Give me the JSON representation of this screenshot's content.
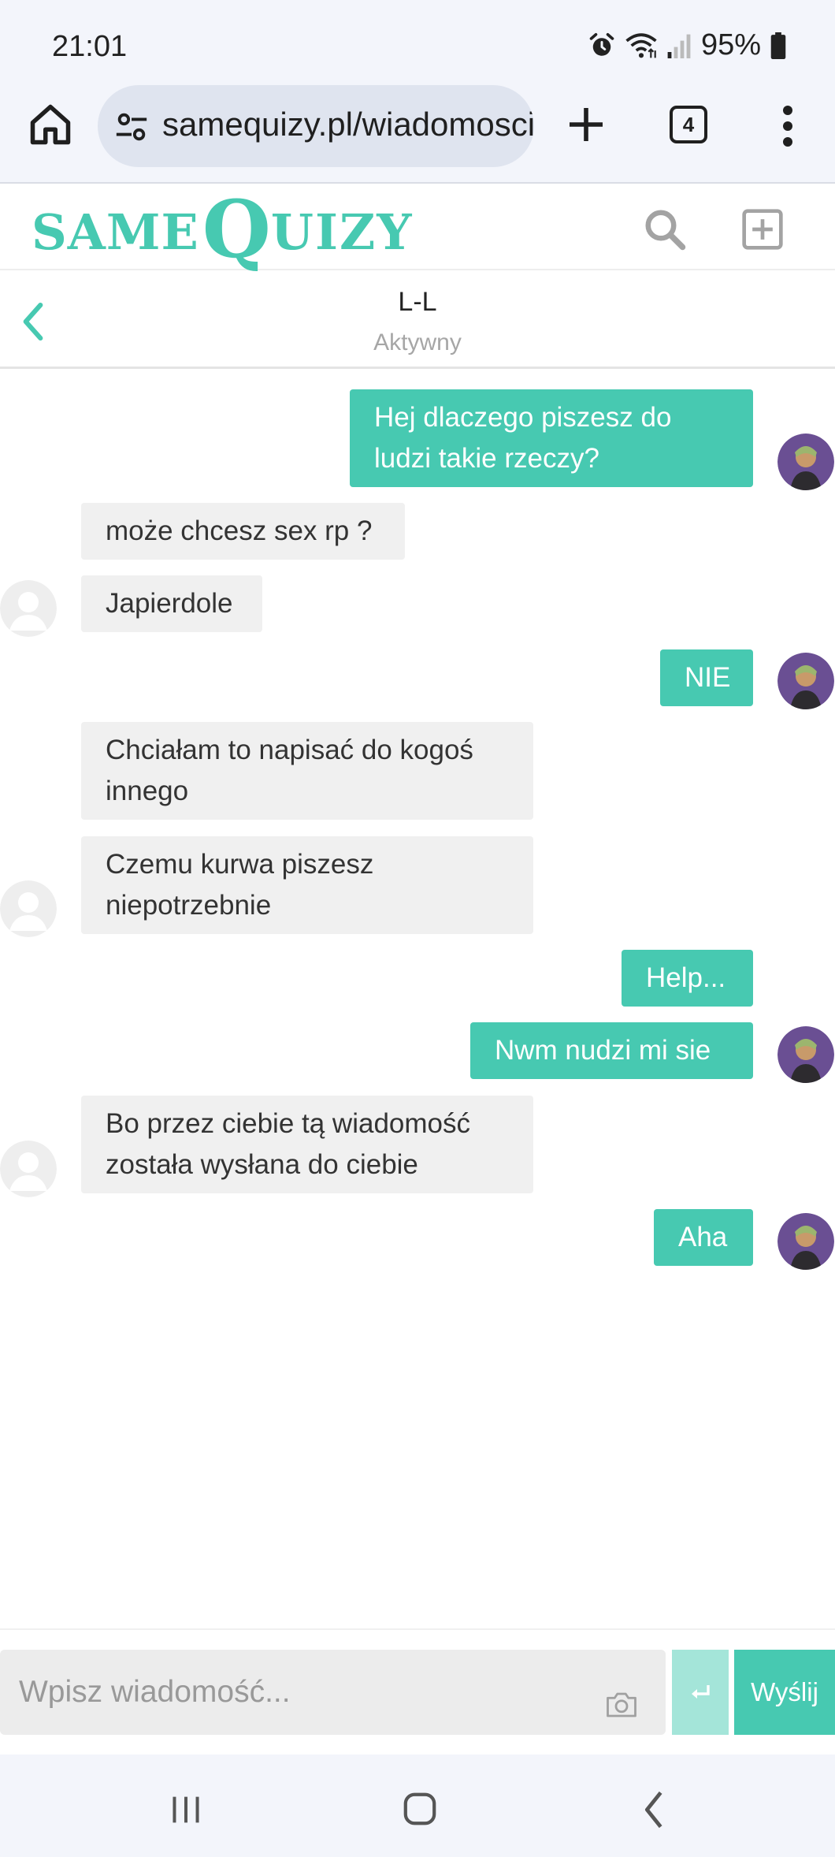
{
  "status_bar": {
    "time": "21:01",
    "battery": "95%",
    "icons": [
      "alarm-icon",
      "wifi-icon",
      "signal-icon",
      "battery-icon"
    ]
  },
  "browser": {
    "url": "samequizy.pl/wiadomosci",
    "tab_count": "4",
    "buttons": [
      "home-icon",
      "site-settings-icon",
      "new-tab-icon",
      "tab-switcher",
      "menu-icon"
    ]
  },
  "site": {
    "logo_same": "SAME",
    "logo_q": "Q",
    "logo_uizy": "UIZY",
    "accent_color": "#47c9b1"
  },
  "conversation": {
    "name": "L-L",
    "status": "Aktywny"
  },
  "messages": [
    {
      "side": "out",
      "text": "Hej dlaczego piszesz do ludzi takie rzeczy?"
    },
    {
      "side": "in",
      "text": "może chcesz sex rp ?"
    },
    {
      "side": "in",
      "text": "Japierdole"
    },
    {
      "side": "out",
      "text": "NIE"
    },
    {
      "side": "in",
      "text": "Chciałam to napisać do kogoś innego"
    },
    {
      "side": "in",
      "text": "Czemu kurwa piszesz niepotrzebnie"
    },
    {
      "side": "out",
      "text": "Help..."
    },
    {
      "side": "out",
      "text": "Nwm nudzi mi sie"
    },
    {
      "side": "in",
      "text": "Bo przez ciebie tą wiadomość została wysłana do ciebie"
    },
    {
      "side": "out",
      "text": "Aha"
    }
  ],
  "composer": {
    "placeholder": "Wpisz wiadomość...",
    "send_label": "Wyślij"
  },
  "nav_bar": {
    "buttons": [
      "recent-apps-icon",
      "home-icon",
      "back-icon"
    ]
  }
}
